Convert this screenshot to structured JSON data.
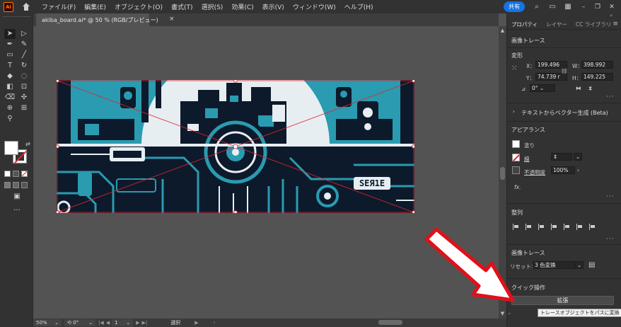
{
  "app": {
    "logo": "Ai"
  },
  "menu": {
    "items": [
      "ファイル(F)",
      "編集(E)",
      "オブジェクト(O)",
      "書式(T)",
      "選択(S)",
      "効果(C)",
      "表示(V)",
      "ウィンドウ(W)",
      "ヘルプ(H)"
    ],
    "share": "共有"
  },
  "document": {
    "tab_title": "akiba_board.ai* @ 50 % (RGB/プレビュー)",
    "tab_close": "×"
  },
  "artwork": {
    "sign_text": "SEЯ1E",
    "colors": {
      "teal": "#2a9bb0",
      "navy": "#0d1a2b",
      "light": "#e6eef2",
      "selection": "#e0262f"
    }
  },
  "status": {
    "zoom": "50%",
    "rotation": "0°",
    "artboard": "1",
    "tool": "選択"
  },
  "panel": {
    "tabs": [
      "プロパティ",
      "レイヤー",
      "CC ライブラリ"
    ],
    "image_trace_top": "画像トレース",
    "transform": {
      "title": "変形",
      "x_label": "X：",
      "x": "199.496",
      "y_label": "Y：",
      "y": "74.739 r",
      "w_label": "W：",
      "w": "398.992",
      "h_label": "H：",
      "h": "149.225",
      "angle": "0°"
    },
    "text_to_vector": "テキストからベクター生成 (Beta)",
    "appearance": {
      "title": "アピアランス",
      "fill": "塗り",
      "stroke": "線",
      "opacity_label": "不透明度",
      "opacity": "100%",
      "fx": "fx."
    },
    "align": {
      "title": "整列"
    },
    "image_trace": {
      "title": "画像トレース",
      "preset_label": "リセット：",
      "preset": "3 色変換"
    },
    "quick_actions": {
      "title": "クイック操作",
      "expand": "拡張"
    },
    "tooltip": "トレースオブジェクトをパスに変換"
  }
}
